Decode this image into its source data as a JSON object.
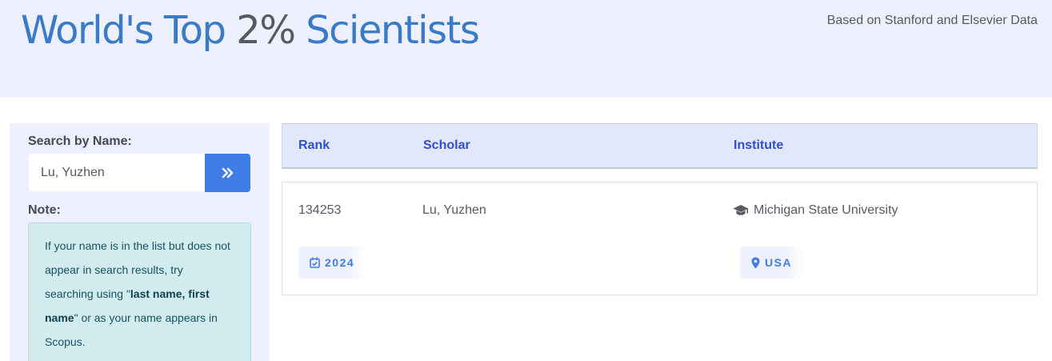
{
  "header": {
    "title_part1": "World's Top ",
    "title_accent": "2%",
    "title_part2": " Scientists",
    "tagline": "Based on Stanford and Elsevier Data"
  },
  "sidebar": {
    "search_label": "Search by Name:",
    "search_value": "Lu, Yuzhen",
    "search_button_icon": "double-chevron-right-icon",
    "note_label": "Note:",
    "note_text_1": "If your name is in the list but does not appear in search results, try searching using \"",
    "note_bold": "last name, first name",
    "note_text_2": "\" or as your name appears in Scopus."
  },
  "table": {
    "columns": [
      "Rank",
      "Scholar",
      "Institute"
    ],
    "rows": [
      {
        "rank": "134253",
        "scholar": "Lu, Yuzhen",
        "institute": "Michigan State University",
        "institute_icon": "graduation-cap-icon",
        "year": "2024",
        "year_icon": "calendar-check-icon",
        "country": "USA",
        "country_icon": "map-marker-icon"
      }
    ]
  },
  "colors": {
    "title_blue": "#3a7bc8",
    "title_gray": "#555a63",
    "header_bg": "#eef0fd",
    "button_blue": "#3f7de6",
    "column_heading": "#2f4fd1",
    "note_bg": "#d2ebef"
  }
}
